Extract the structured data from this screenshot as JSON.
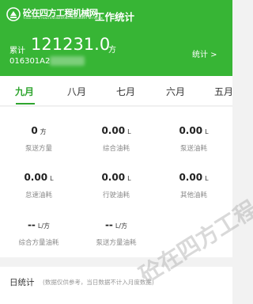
{
  "header": {
    "logo_text": "砼在四方工程机械网",
    "logo_sub": "TONG ZAI SI FANG ENGINEERING MACHINERY NETWORK",
    "title": "工作统计",
    "total_label": "累计",
    "total_value": "121231.0",
    "total_unit": "方",
    "stats_link": "统计 >",
    "device_id": "016301A2"
  },
  "tabs": [
    "九月",
    "八月",
    "七月",
    "六月",
    "五月"
  ],
  "metrics": [
    {
      "value": "0",
      "unit": "方",
      "label": "泵送方量"
    },
    {
      "value": "0.00",
      "unit": "L",
      "label": "综合油耗"
    },
    {
      "value": "0.00",
      "unit": "L",
      "label": "泵送油耗"
    },
    {
      "value": "0.00",
      "unit": "L",
      "label": "怠速油耗"
    },
    {
      "value": "0.00",
      "unit": "L",
      "label": "行驶油耗"
    },
    {
      "value": "0.00",
      "unit": "L",
      "label": "其他油耗"
    },
    {
      "value": "--",
      "unit": "L/方",
      "label": "综合方量油耗"
    },
    {
      "value": "--",
      "unit": "L/方",
      "label": "泵送方量油耗"
    }
  ],
  "daily": {
    "title": "日统计",
    "note": "(数据仅供参考，当日数据不计入月度数据)"
  },
  "watermark": "砼在四方工程",
  "colors": {
    "header_green": "#37b535",
    "accent_green": "#2fa52f"
  }
}
